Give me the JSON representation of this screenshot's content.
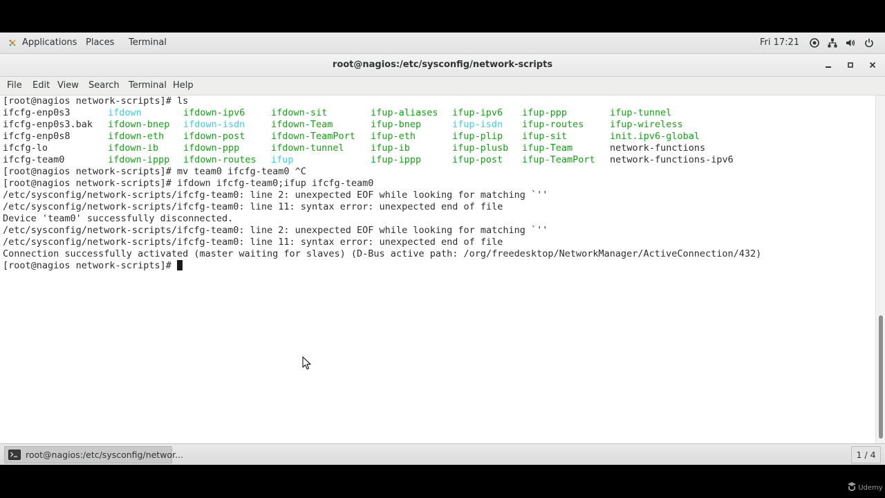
{
  "topbar": {
    "applications": "Applications",
    "places": "Places",
    "terminal": "Terminal",
    "clock": "Fri 17:21",
    "tray_icons": [
      "accessibility-icon",
      "network-icon",
      "volume-icon",
      "power-icon"
    ]
  },
  "window": {
    "title": "root@nagios:/etc/sysconfig/network-scripts",
    "buttons": [
      "minimize-icon",
      "maximize-icon",
      "close-icon"
    ]
  },
  "menu": [
    "File",
    "Edit",
    "View",
    "Search",
    "Terminal",
    "Help"
  ],
  "terminal": {
    "prompt_ls": "[root@nagios network-scripts]# ls",
    "ls_rows": [
      [
        {
          "t": "ifcfg-enp0s3",
          "c": "dark"
        },
        {
          "t": "ifdown",
          "c": "cyan"
        },
        {
          "t": "ifdown-ipv6",
          "c": "green"
        },
        {
          "t": "ifdown-sit",
          "c": "green"
        },
        {
          "t": "ifup-aliases",
          "c": "green"
        },
        {
          "t": "ifup-ipv6",
          "c": "green"
        },
        {
          "t": "ifup-ppp",
          "c": "green"
        },
        {
          "t": "ifup-tunnel",
          "c": "green"
        }
      ],
      [
        {
          "t": "ifcfg-enp0s3.bak",
          "c": "dark"
        },
        {
          "t": "ifdown-bnep",
          "c": "green"
        },
        {
          "t": "ifdown-isdn",
          "c": "cyan"
        },
        {
          "t": "ifdown-Team",
          "c": "green"
        },
        {
          "t": "ifup-bnep",
          "c": "green"
        },
        {
          "t": "ifup-isdn",
          "c": "cyan"
        },
        {
          "t": "ifup-routes",
          "c": "green"
        },
        {
          "t": "ifup-wireless",
          "c": "green"
        }
      ],
      [
        {
          "t": "ifcfg-enp0s8",
          "c": "dark"
        },
        {
          "t": "ifdown-eth",
          "c": "green"
        },
        {
          "t": "ifdown-post",
          "c": "green"
        },
        {
          "t": "ifdown-TeamPort",
          "c": "green"
        },
        {
          "t": "ifup-eth",
          "c": "green"
        },
        {
          "t": "ifup-plip",
          "c": "green"
        },
        {
          "t": "ifup-sit",
          "c": "green"
        },
        {
          "t": "init.ipv6-global",
          "c": "green"
        }
      ],
      [
        {
          "t": "ifcfg-lo",
          "c": "dark"
        },
        {
          "t": "ifdown-ib",
          "c": "green"
        },
        {
          "t": "ifdown-ppp",
          "c": "green"
        },
        {
          "t": "ifdown-tunnel",
          "c": "green"
        },
        {
          "t": "ifup-ib",
          "c": "green"
        },
        {
          "t": "ifup-plusb",
          "c": "green"
        },
        {
          "t": "ifup-Team",
          "c": "green"
        },
        {
          "t": "network-functions",
          "c": "dark"
        }
      ],
      [
        {
          "t": "ifcfg-team0",
          "c": "dark"
        },
        {
          "t": "ifdown-ippp",
          "c": "green"
        },
        {
          "t": "ifdown-routes",
          "c": "green"
        },
        {
          "t": "ifup",
          "c": "cyan"
        },
        {
          "t": "ifup-ippp",
          "c": "green"
        },
        {
          "t": "ifup-post",
          "c": "green"
        },
        {
          "t": "ifup-TeamPort",
          "c": "green"
        },
        {
          "t": "network-functions-ipv6",
          "c": "dark"
        }
      ]
    ],
    "output": [
      "[root@nagios network-scripts]# mv team0 ifcfg-team0 ^C",
      "[root@nagios network-scripts]# ifdown ifcfg-team0;ifup ifcfg-team0",
      "/etc/sysconfig/network-scripts/ifcfg-team0: line 2: unexpected EOF while looking for matching `''",
      "/etc/sysconfig/network-scripts/ifcfg-team0: line 11: syntax error: unexpected end of file",
      "Device 'team0' successfully disconnected.",
      "/etc/sysconfig/network-scripts/ifcfg-team0: line 2: unexpected EOF while looking for matching `''",
      "/etc/sysconfig/network-scripts/ifcfg-team0: line 11: syntax error: unexpected end of file",
      "Connection successfully activated (master waiting for slaves) (D-Bus active path: /org/freedesktop/NetworkManager/ActiveConnection/432)"
    ],
    "final_prompt": "[root@nagios network-scripts]# "
  },
  "taskbar": {
    "task_label": "root@nagios:/etc/sysconfig/networ...",
    "workspace": "1 / 4"
  },
  "watermark": "Udemy",
  "colors": {
    "green": "#12a312",
    "cyan": "#3ad0e0",
    "dark": "#2e2e2e"
  }
}
